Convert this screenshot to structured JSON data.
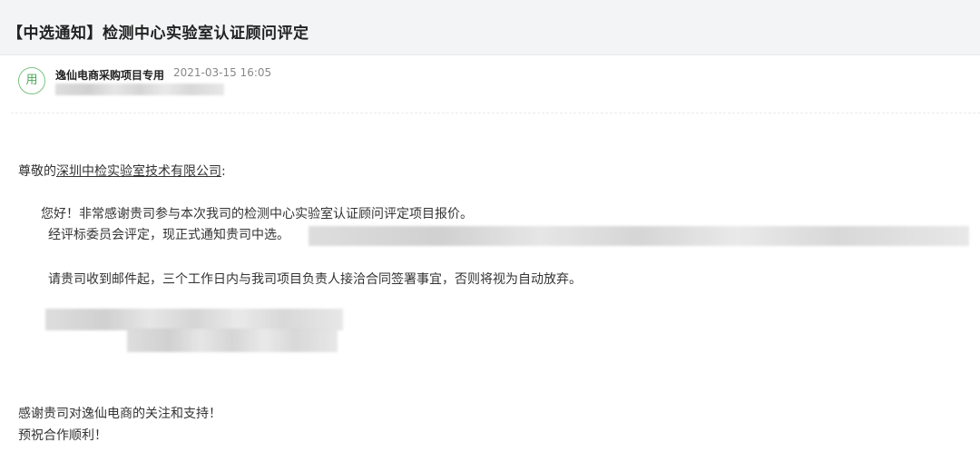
{
  "email": {
    "subject": "【中选通知】检测中心实验室认证顾问评定",
    "sender": {
      "avatar_char": "用",
      "name": "逸仙电商采购项目专用",
      "time": "2021-03-15 16:05"
    },
    "body": {
      "greeting_prefix": "尊敬的",
      "greeting_company": "深圳中检实验室技术有限公司",
      "greeting_suffix": ":",
      "para1": "您好！非常感谢贵司参与本次我司的检测中心实验室认证顾问评定项目报价。",
      "para2": "经评标委员会评定，现正式通知贵司中选。",
      "para3": "请贵司收到邮件起，三个工作日内与我司项目负责人接洽合同签署事宜，否则将视为自动放弃。",
      "closing1": "感谢贵司对逸仙电商的关注和支持！",
      "closing2": "预祝合作顺利！"
    }
  },
  "colors": {
    "title_bar_bg": "#f3f4f6",
    "avatar_green": "#4aa852",
    "text": "#333333",
    "muted": "#888888"
  }
}
